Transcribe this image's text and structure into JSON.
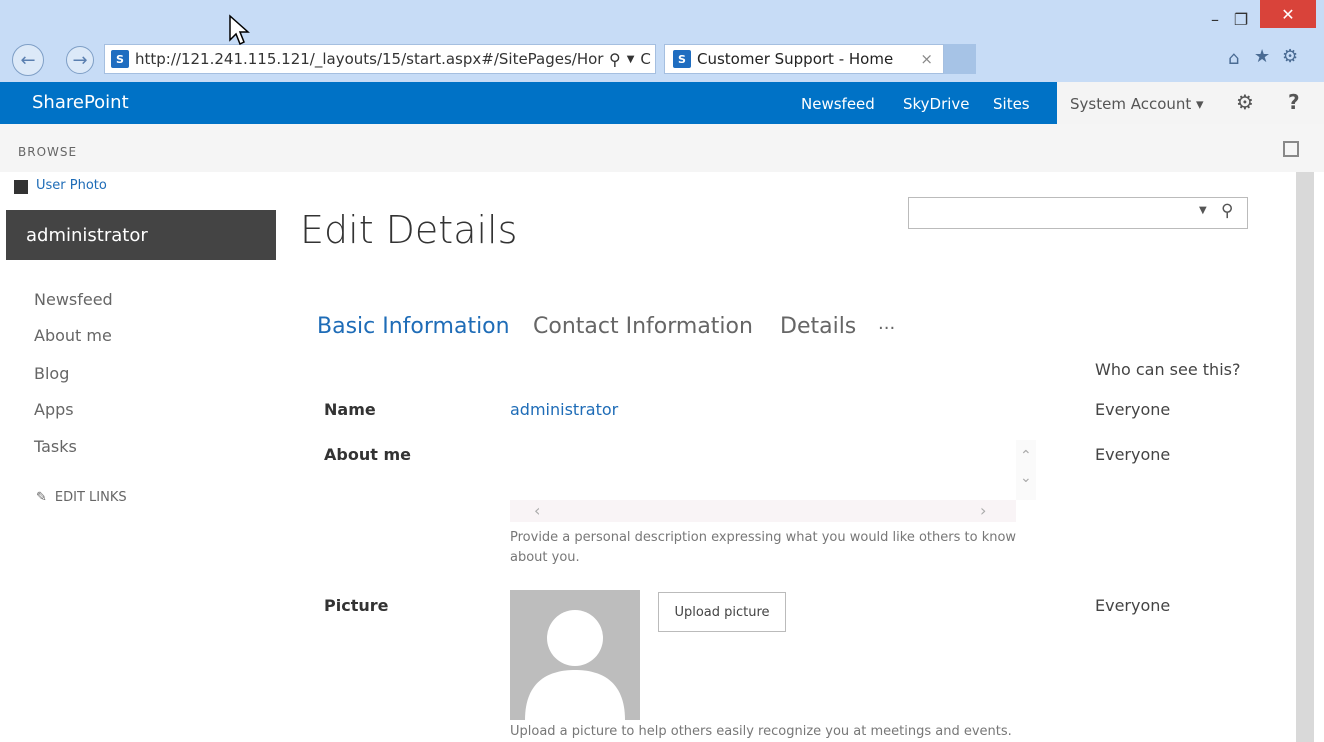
{
  "browser": {
    "address": "http://121.241.115.121/_layouts/15/start.aspx#/SitePages/Hor",
    "tab_title": "Customer Support - Home",
    "favicon_letter": "S",
    "refresh": "C"
  },
  "suite": {
    "brand": "SharePoint",
    "links": [
      "Newsfeed",
      "SkyDrive",
      "Sites"
    ],
    "account": "System Account ▾",
    "help": "?"
  },
  "ribbon": {
    "browse": "BROWSE"
  },
  "left_nav": {
    "user_photo": "User Photo",
    "username": "administrator",
    "items": [
      "Newsfeed",
      "About me",
      "Blog",
      "Apps",
      "Tasks"
    ],
    "edit_links": "EDIT LINKS"
  },
  "page": {
    "title": "Edit Details",
    "tabs": [
      "Basic Information",
      "Contact Information",
      "Details",
      "···"
    ],
    "who_header": "Who can see this?",
    "fields": {
      "name_label": "Name",
      "name_value": "administrator",
      "name_vis": "Everyone",
      "about_label": "About me",
      "about_vis": "Everyone",
      "about_hint": "Provide a personal description expressing what you would like others to know about you.",
      "picture_label": "Picture",
      "picture_vis": "Everyone",
      "upload_label": "Upload picture",
      "picture_hint": "Upload a picture to help others easily recognize you at meetings and events."
    }
  },
  "colors": {
    "suite_blue": "#0072c6",
    "link_blue": "#1e6cb7"
  }
}
